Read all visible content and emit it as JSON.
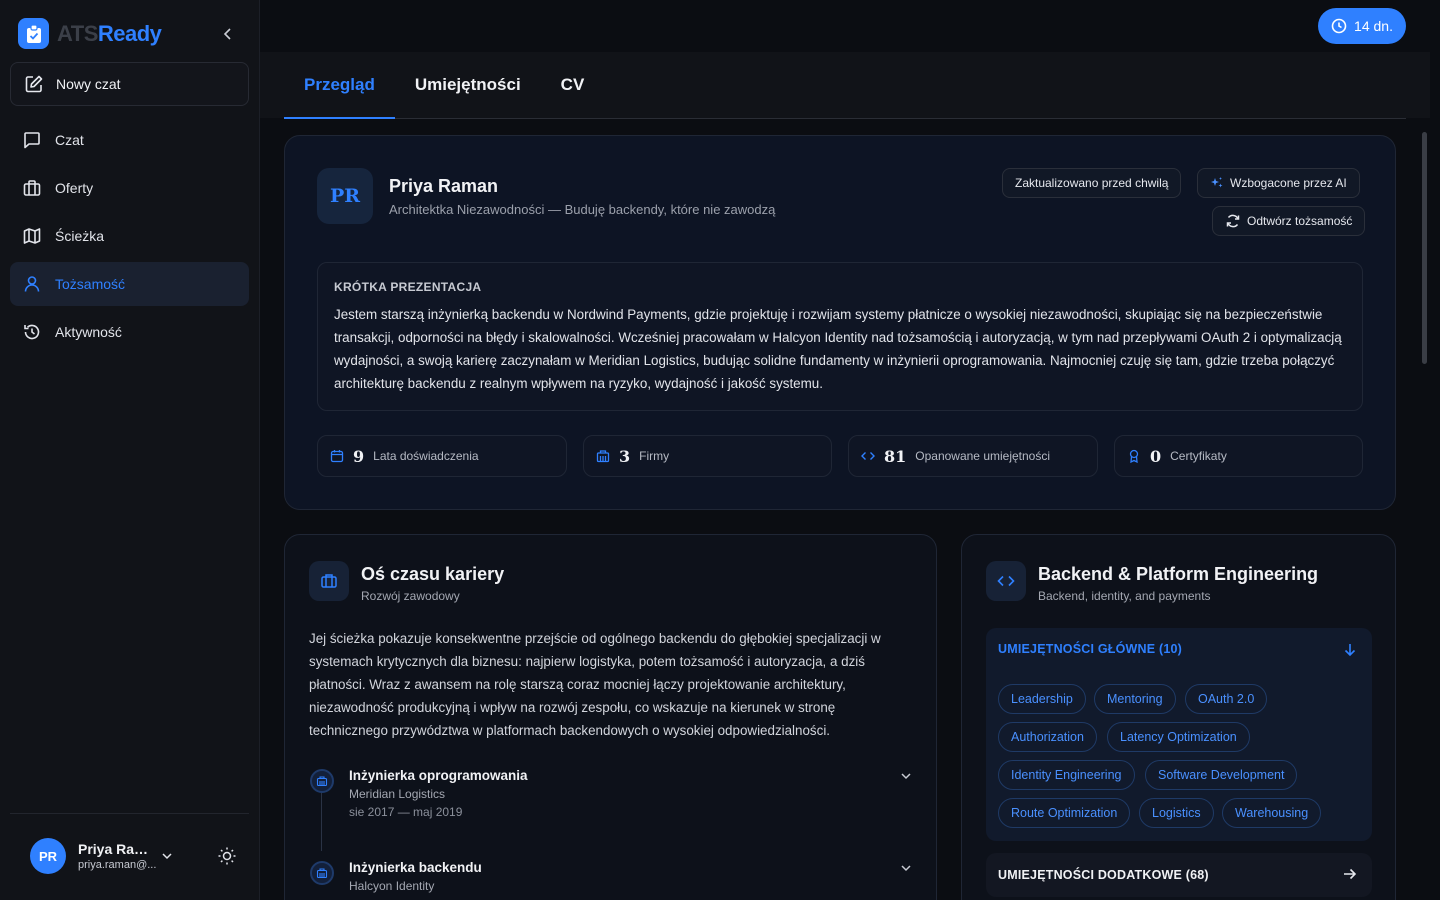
{
  "brand": {
    "name_a": "ATS",
    "name_b": "Ready",
    "accent": "#2f80ff"
  },
  "sidebar": {
    "new_chat": "Nowy czat",
    "items": [
      {
        "label": "Czat",
        "icon": "chat-icon",
        "active": false
      },
      {
        "label": "Oferty",
        "icon": "briefcase-icon",
        "active": false
      },
      {
        "label": "Ścieżka",
        "icon": "map-icon",
        "active": false
      },
      {
        "label": "Tożsamość",
        "icon": "user-icon",
        "active": true
      },
      {
        "label": "Aktywność",
        "icon": "history-icon",
        "active": false
      }
    ],
    "user": {
      "initials": "PR",
      "name": "Priya Ram...",
      "email": "priya.raman@..."
    }
  },
  "header": {
    "trial": "14 dn.",
    "tabs": [
      {
        "label": "Przegląd",
        "active": true
      },
      {
        "label": "Umiejętności",
        "active": false
      },
      {
        "label": "CV",
        "active": false
      }
    ]
  },
  "profile": {
    "initials": "PR",
    "name": "Priya Raman",
    "headline": "Architektka Niezawodności — Buduję backendy, które nie zawodzą",
    "updated": "Zaktualizowano przed chwilą",
    "ai_badge": "Wzbogacone przez AI",
    "rebuild": "Odtwórz tożsamość",
    "bio_label": "KRÓTKA PREZENTACJA",
    "bio": "Jestem starszą inżynierką backendu w Nordwind Payments, gdzie projektuję i rozwijam systemy płatnicze o wysokiej niezawodności, skupiając się na bezpieczeństwie transakcji, odporności na błędy i skalowalności. Wcześniej pracowałam w Halcyon Identity nad tożsamością i autoryzacją, w tym nad przepływami OAuth 2 i optymalizacją wydajności, a swoją karierę zaczynałam w Meridian Logistics, budując solidne fundamenty w inżynierii oprogramowania. Najmocniej czuję się tam, gdzie trzeba połączyć architekturę backendu z realnym wpływem na ryzyko, wydajność i jakość systemu.",
    "stats": [
      {
        "value": "9",
        "label": "Lata doświadczenia",
        "icon": "calendar-icon"
      },
      {
        "value": "3",
        "label": "Firmy",
        "icon": "building-icon"
      },
      {
        "value": "81",
        "label": "Opanowane umiejętności",
        "icon": "code-icon"
      },
      {
        "value": "0",
        "label": "Certyfikaty",
        "icon": "award-icon"
      }
    ]
  },
  "timeline": {
    "title": "Oś czasu kariery",
    "subtitle": "Rozwój zawodowy",
    "text": "Jej ścieżka pokazuje konsekwentne przejście od ogólnego backendu do głębokiej specjalizacji w systemach krytycznych dla biznesu: najpierw logistyka, potem tożsamość i autoryzacja, a dziś płatności. Wraz z awansem na rolę starszą coraz mocniej łączy projektowanie architektury, niezawodność produkcyjną i wpływ na rozwój zespołu, co wskazuje na kierunek w stronę technicznego przywództwa w platformach backendowych o wysokiej odpowiedzialności.",
    "entries": [
      {
        "role": "Inżynierka oprogramowania",
        "company": "Meridian Logistics",
        "dates": "sie 2017 — maj 2019"
      },
      {
        "role": "Inżynierka backendu",
        "company": "Halcyon Identity",
        "dates": ""
      }
    ]
  },
  "skills": {
    "title": "Backend & Platform Engineering",
    "subtitle": "Backend, identity, and payments",
    "core_label": "UMIEJĘTNOŚCI GŁÓWNE (10)",
    "core_tags": [
      "Leadership",
      "Mentoring",
      "OAuth 2.0",
      "Authorization",
      "Latency Optimization",
      "Identity Engineering",
      "Software Development",
      "Route Optimization",
      "Logistics",
      "Warehousing"
    ],
    "extra_label": "UMIEJĘTNOŚCI DODATKOWE (68)"
  }
}
